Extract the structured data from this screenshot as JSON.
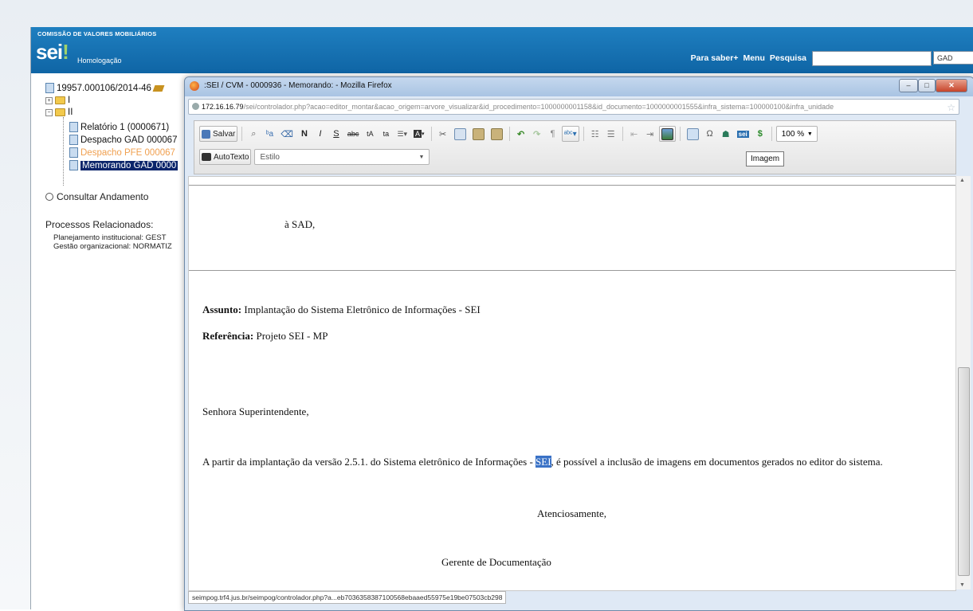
{
  "header": {
    "org": "COMISSÃO DE VALORES MOBILIÁRIOS",
    "logo": "sei",
    "environment": "Homologação",
    "links": [
      "Para saber+",
      "Menu",
      "Pesquisa"
    ],
    "search_value": "",
    "unit": "GAD"
  },
  "tree": {
    "process_number": "19957.000106/2014-46",
    "nodes": [
      {
        "label": "I",
        "type": "folder"
      },
      {
        "label": "II",
        "type": "folder"
      },
      {
        "label": "Relatório 1 (0000671)",
        "type": "doc"
      },
      {
        "label": "Despacho GAD 000067",
        "type": "doc"
      },
      {
        "label": "Despacho PFE 000067",
        "type": "doc",
        "status": "orange"
      },
      {
        "label": "Memorando GAD 0000",
        "type": "doc",
        "status": "selected"
      }
    ],
    "consult_label": "Consultar Andamento",
    "related_title": "Processos Relacionados:",
    "related_items": [
      "Planejamento institucional: GEST",
      "Gestão organizacional: NORMATIZ"
    ]
  },
  "popup": {
    "title": ":SEI / CVM - 0000936 - Memorando: - Mozilla Firefox",
    "url_host": "172.16.16.79",
    "url_path": "/sei/controlador.php?acao=editor_montar&acao_origem=arvore_visualizar&id_procedimento=1000000001158&id_documento=1000000001555&infra_sistema=100000100&infra_unidade",
    "toolbar": {
      "save_label": "Salvar",
      "autotexto_label": "AutoTexto",
      "style_label": "Estilo",
      "zoom_value": "100 %",
      "tooltip": "Imagem"
    },
    "document": {
      "to": "à SAD,",
      "assunto_label": "Assunto:",
      "assunto_value": "Implantação do Sistema Eletrônico de Informações - SEI",
      "referencia_label": "Referência:",
      "referencia_value": "Projeto SEI - MP",
      "salutation": "Senhora Superintendente,",
      "body_before": "A partir da implantação da versão 2.5.1. do Sistema eletrônico de Informações - ",
      "body_highlight": "SEI",
      "body_after": ", é possível a inclusão de imagens em documentos gerados no editor do sistema.",
      "closing": "Atenciosamente,",
      "signature": "Gerente de Documentação"
    },
    "status_url": "seimpog.trf4.jus.br/seimpog/controlador.php?a...eb7036358387100568ebaaed55975e19be07503cb298"
  }
}
